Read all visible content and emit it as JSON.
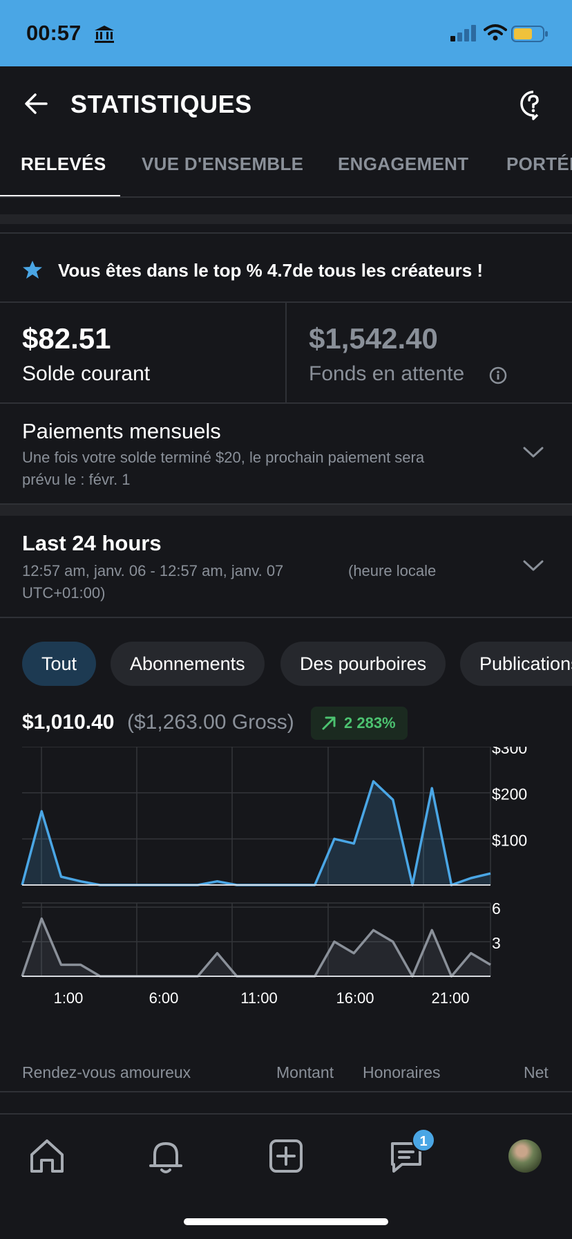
{
  "status_bar": {
    "time": "00:57",
    "battery_color": "#f0c23b"
  },
  "header": {
    "title": "STATISTIQUES"
  },
  "tabs": [
    {
      "label": "RELEVÉS",
      "active": true
    },
    {
      "label": "VUE D'ENSEMBLE",
      "active": false
    },
    {
      "label": "ENGAGEMENT",
      "active": false
    },
    {
      "label": "PORTÉE",
      "active": false
    }
  ],
  "banner": {
    "text": "Vous êtes dans le top % 4.7de tous les créateurs !"
  },
  "balances": {
    "current_amount": "$82.51",
    "current_label": "Solde courant",
    "pending_amount": "$1,542.40",
    "pending_label": "Fonds en attente"
  },
  "monthly": {
    "title": "Paiements mensuels",
    "desc_line1": "Une fois votre solde terminé $20, le prochain paiement sera",
    "desc_line2": "prévu le : févr. 1"
  },
  "period": {
    "title": "Last 24 hours",
    "range": "12:57 am, janv. 06 - 12:57 am, janv. 07",
    "tz_a": "(heure locale",
    "tz_b": "UTC+01:00)"
  },
  "chips": [
    {
      "label": "Tout",
      "active": true
    },
    {
      "label": "Abonnements",
      "active": false
    },
    {
      "label": "Des pourboires",
      "active": false
    },
    {
      "label": "Publications",
      "active": false
    }
  ],
  "summary": {
    "net": "$1,010.40",
    "gross": "($1,263.00 Gross)",
    "trend": "2 283%"
  },
  "chart_data": [
    {
      "type": "area",
      "x_ticks": [
        "1:00",
        "6:00",
        "11:00",
        "16:00",
        "21:00"
      ],
      "y_ticks": [
        "$300",
        "$200",
        "$100"
      ],
      "ylim": [
        0,
        300
      ],
      "values": [
        0,
        160,
        18,
        8,
        0,
        0,
        0,
        0,
        0,
        0,
        8,
        0,
        0,
        0,
        0,
        0,
        100,
        90,
        225,
        185,
        0,
        210,
        0,
        15,
        25
      ],
      "color": "#4aa6e5"
    },
    {
      "type": "area",
      "y_ticks": [
        "6",
        "3"
      ],
      "ylim": [
        0,
        6
      ],
      "values": [
        0,
        5,
        1,
        1,
        0,
        0,
        0,
        0,
        0,
        0,
        2,
        0,
        0,
        0,
        0,
        0,
        3,
        2,
        4,
        3,
        0,
        4,
        0,
        2,
        1
      ],
      "color": "#8a9099"
    }
  ],
  "table_header": {
    "col1": "Rendez-vous amoureux",
    "col2": "Montant",
    "col3": "Honoraires",
    "col4": "Net"
  },
  "nav": {
    "messages_badge": "1"
  }
}
